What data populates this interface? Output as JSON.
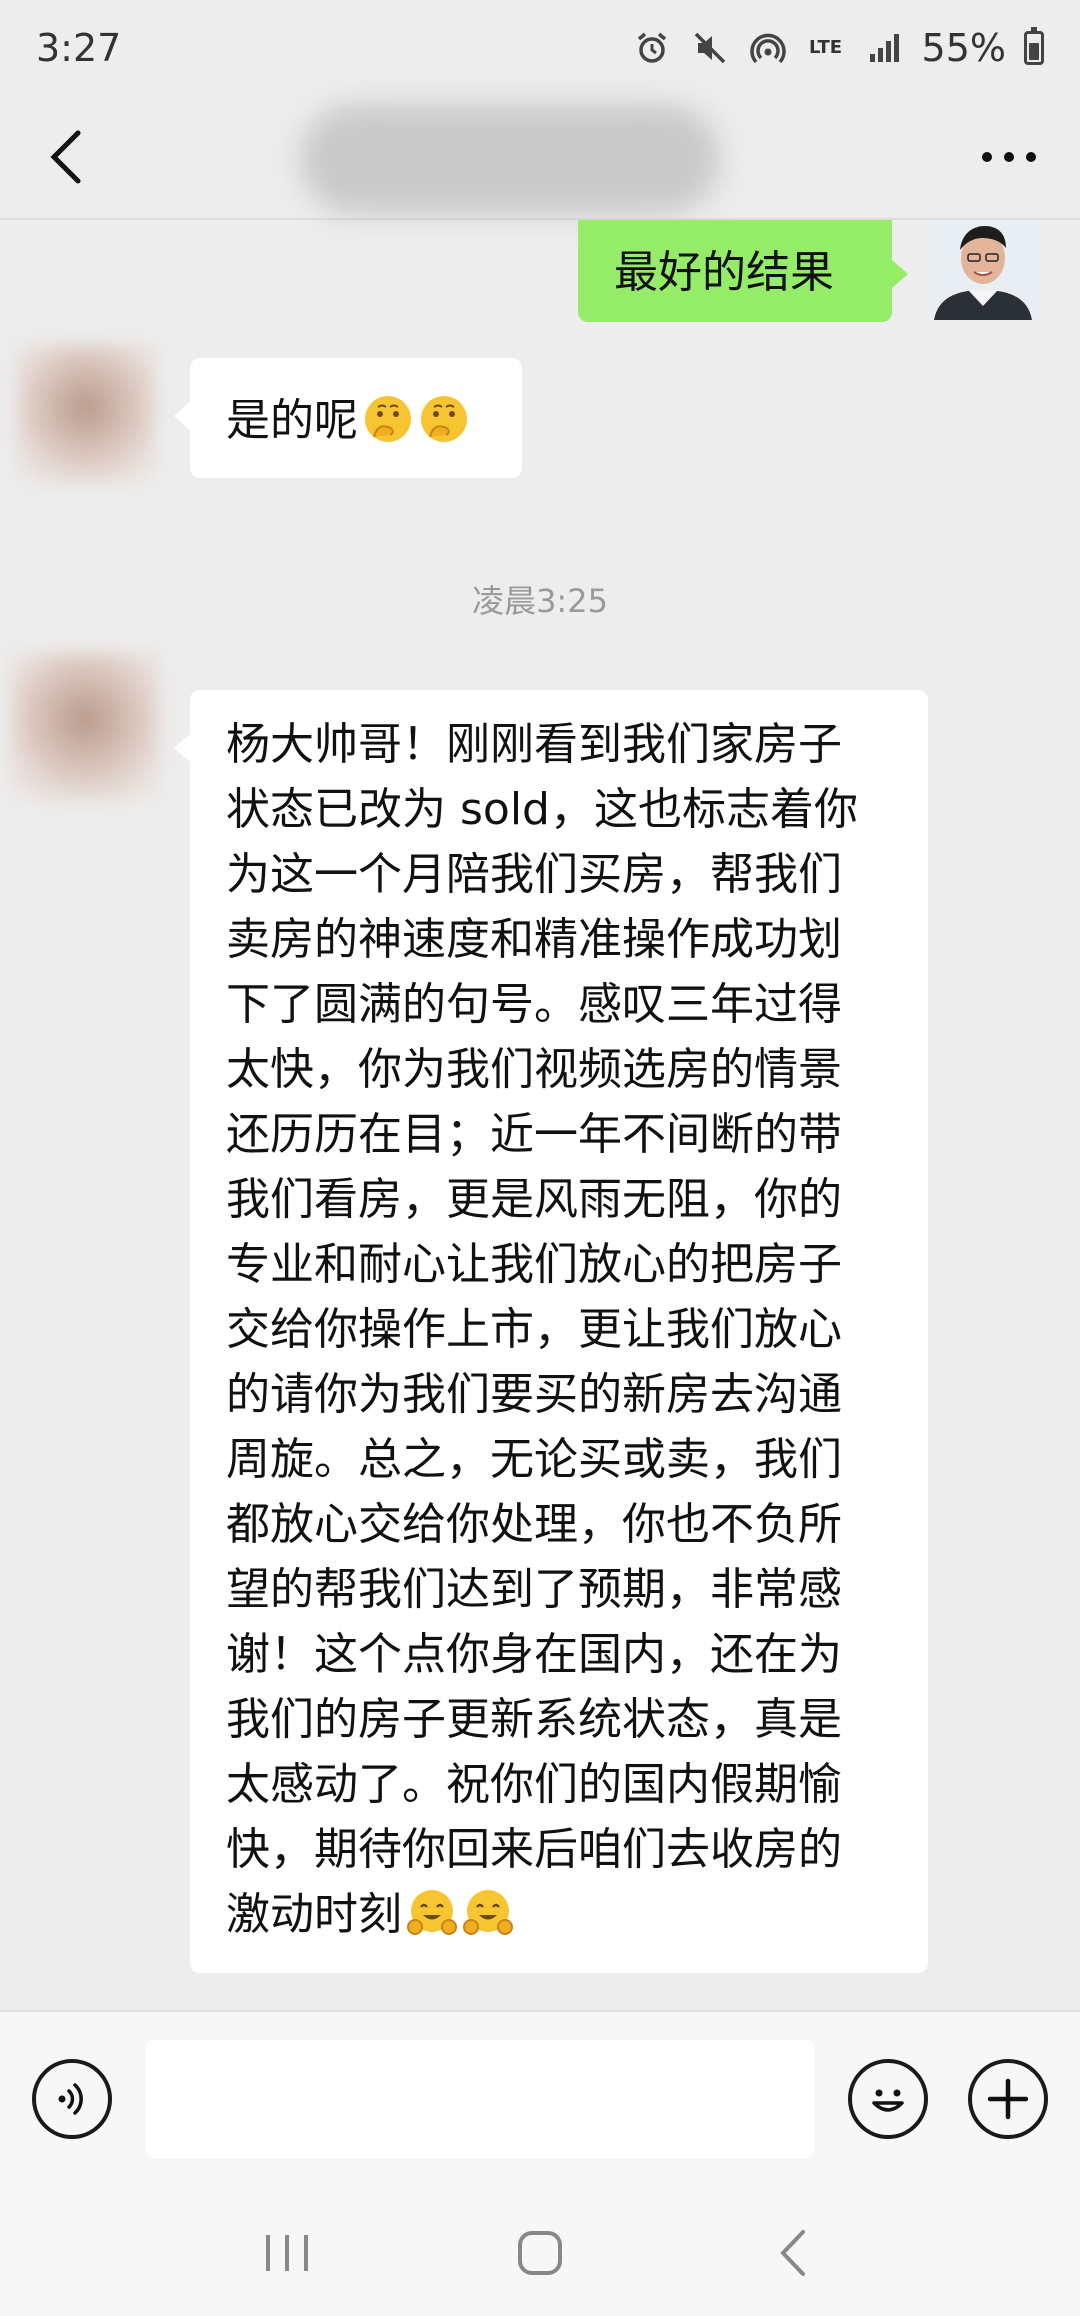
{
  "status_bar": {
    "time": "3:27",
    "network": "LTE",
    "battery": "55%",
    "icons": [
      "alarm-icon",
      "mute-icon",
      "hotspot-icon",
      "lte-icon",
      "signal-icon",
      "battery-icon"
    ]
  },
  "header": {
    "back_icon": "chevron-left-icon",
    "title": "",
    "more_label": "···"
  },
  "messages": [
    {
      "side": "right",
      "text": "最好的结果"
    },
    {
      "side": "left",
      "text": "是的呢",
      "emojis": [
        "thinking-emoji",
        "thinking-emoji"
      ]
    },
    {
      "type": "timestamp",
      "text": "凌晨3:25"
    },
    {
      "side": "left",
      "lines": [
        "杨大帅哥！刚刚看到我们家房子",
        "状态已改为 sold，这也标志着你",
        "为这一个月陪我们买房，帮我们",
        "卖房的神速度和精准操作成功划",
        "下了圆满的句号。感叹三年过得",
        "太快，你为我们视频选房的情景",
        "还历历在目；近一年不间断的带",
        "我们看房，更是风雨无阻，你的",
        "专业和耐心让我们放心的把房子",
        "交给你操作上市，更让我们放心",
        "的请你为我们要买的新房去沟通",
        "周旋。总之，无论买或卖，我们",
        "都放心交给你处理，你也不负所",
        "望的帮我们达到了预期，非常感",
        "谢！这个点你身在国内，还在为",
        "我们的房子更新系统状态，真是",
        "太感动了。祝你们的国内假期愉",
        "快，期待你回来后咱们去收房的",
        "激动时刻"
      ],
      "emojis": [
        "hugging-emoji",
        "hugging-emoji"
      ]
    }
  ],
  "input_bar": {
    "voice_icon": "voice-icon",
    "placeholder": "",
    "emoji_icon": "smiley-icon",
    "plus_icon": "plus-icon"
  },
  "nav_bar": {
    "icons": [
      "recents-icon",
      "home-icon",
      "back-icon"
    ]
  },
  "colors": {
    "background": "#ededed",
    "sent_bubble": "#95ec69",
    "received_bubble": "#ffffff",
    "timestamp": "#9a9a9a"
  }
}
